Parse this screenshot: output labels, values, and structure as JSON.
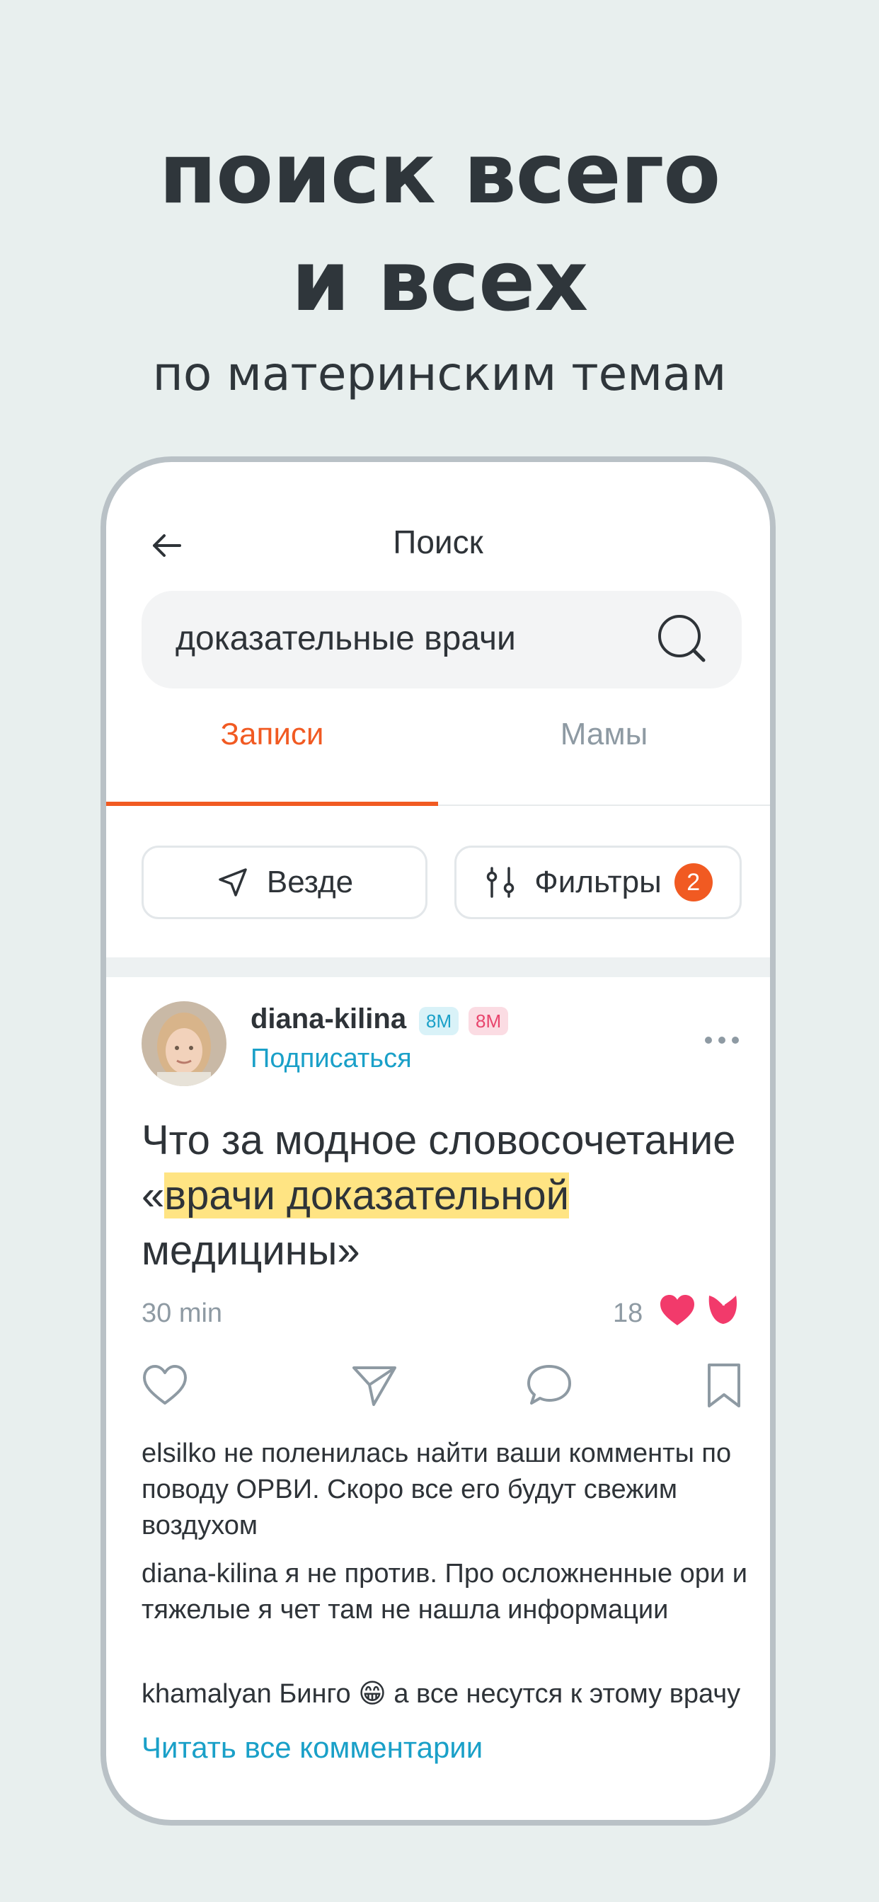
{
  "hero": {
    "title_line1": "поиск всего",
    "title_line2": "и всех",
    "subtitle": "по материнским темам"
  },
  "header": {
    "title": "Поиск",
    "back_icon": "arrow-left-icon"
  },
  "search": {
    "value": "доказательные врачи",
    "icon": "search-icon"
  },
  "tabs": [
    {
      "label": "Записи",
      "active": true
    },
    {
      "label": "Мамы",
      "active": false
    }
  ],
  "chips": {
    "where_label": "Везде",
    "filters_label": "Фильтры",
    "filters_count": "2"
  },
  "post": {
    "author": "diana-kilina",
    "tag1": "8М",
    "tag2": "8М",
    "subscribe": "Подписаться",
    "text_part1": "Что за модное словосочетание «",
    "text_highlight": "врачи доказательной",
    "text_part2": " медицины»",
    "time": "30 min",
    "likes": "18"
  },
  "comments": [
    {
      "author": "elsilko",
      "text": "не поленилась найти ваши комменты по поводу ОРВИ. Скоро все его будут свежим воздухом"
    },
    {
      "author": "diana-kilina",
      "text": "я не против. Про осложненные ори и тяжелые я чет там не нашла информации"
    },
    {
      "author": "khamalyan",
      "text": "Бинго 😁 а все несутся к этому врачу"
    }
  ],
  "read_all": "Читать все комментарии",
  "colors": {
    "accent": "#f15a22",
    "link": "#1aa0c8",
    "highlight": "#ffe483",
    "background": "#e8efee"
  }
}
